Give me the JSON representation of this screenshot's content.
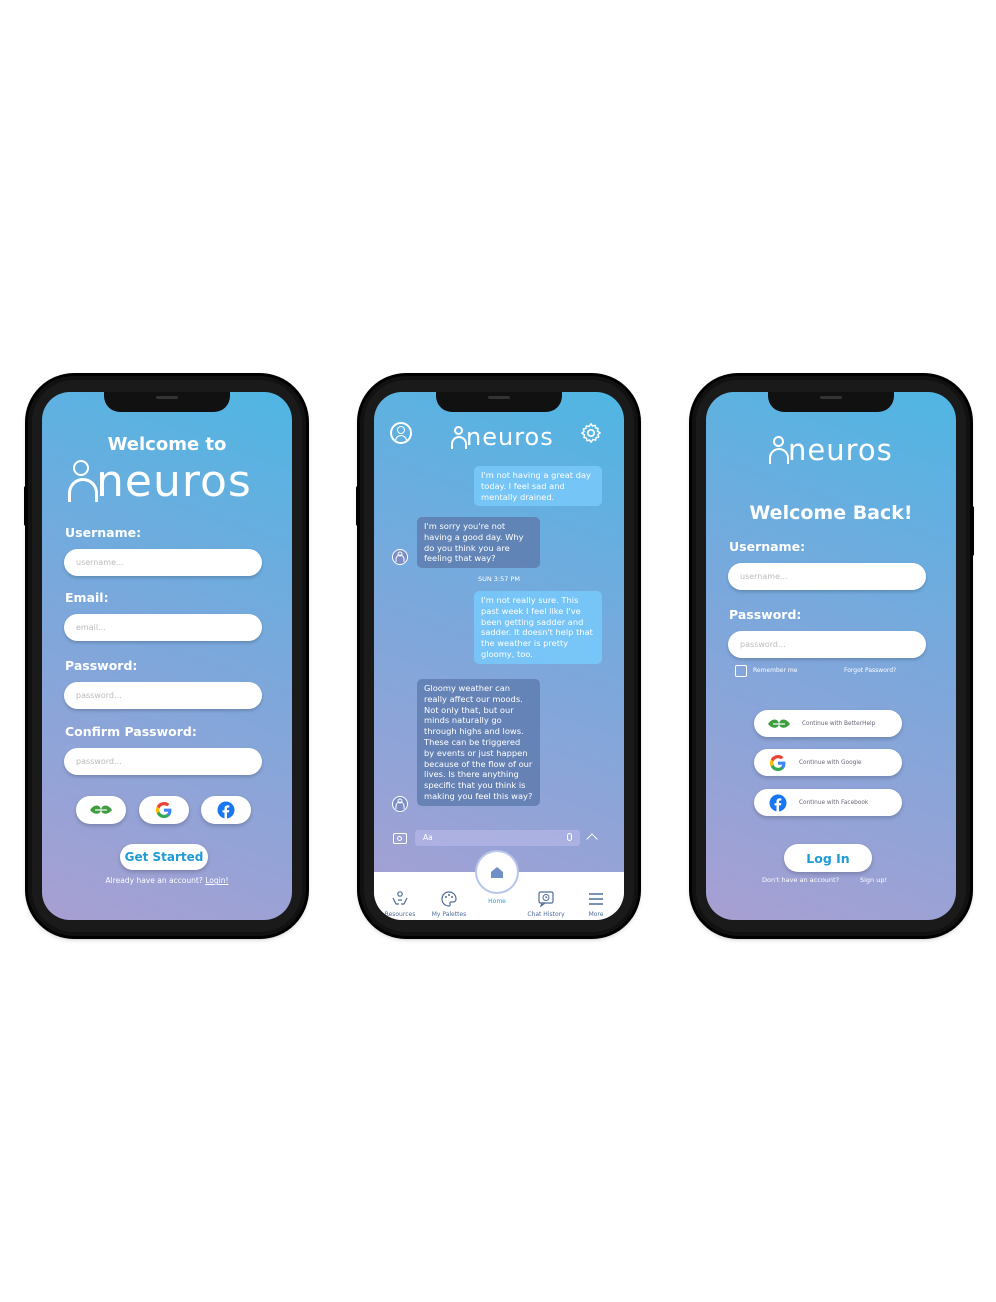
{
  "signup": {
    "welcome_to": "Welcome to",
    "brand": "neuros",
    "username_label": "Username:",
    "username_placeholder": "username...",
    "email_label": "Email:",
    "email_placeholder": "email...",
    "password_label": "Password:",
    "password_placeholder": "password...",
    "confirm_label": "Confirm Password:",
    "confirm_placeholder": "password...",
    "get_started": "Get Started",
    "already": "Already have an account?",
    "login_link": "Login!"
  },
  "chat": {
    "brand": "neuros",
    "messages": [
      {
        "from": "user",
        "text": "I'm not having a great day today. I feel sad and mentally drained."
      },
      {
        "from": "bot",
        "text": "I'm sorry you're not having a good day. Why do you think you are feeling that way?"
      },
      {
        "from": "user",
        "text": "I'm not really sure. This past week I feel like I've been getting sadder and sadder. It doesn't help that the weather is pretty gloomy, too."
      },
      {
        "from": "bot",
        "text": "Gloomy weather can really affect our moods. Not only that, but our minds naturally go through highs and lows. These can be triggered by events or just happen because of the flow of our lives. Is there anything specific that you think is making you feel this way?"
      }
    ],
    "timestamp": "SUN 3:57 PM",
    "input_placeholder": "Aa",
    "tabs": [
      "Resources",
      "My Palettes",
      "Home",
      "Chat History",
      "More"
    ]
  },
  "login": {
    "brand": "neuros",
    "welcome_back": "Welcome Back!",
    "username_label": "Username:",
    "username_placeholder": "username...",
    "password_label": "Password:",
    "password_placeholder": "password...",
    "remember_me": "Remember me",
    "forgot": "Forgot Password?",
    "continue_betterhelp": "Continue with BetterHelp",
    "continue_google": "Continue with Google",
    "continue_facebook": "Continue with Facebook",
    "login_button": "Log In",
    "no_account": "Don't have an account?",
    "signup_link": "Sign up!"
  },
  "colors": {
    "accent": "#1f9bd6",
    "gradient_top": "#4fb6e3",
    "gradient_bottom": "#a89fd2"
  }
}
